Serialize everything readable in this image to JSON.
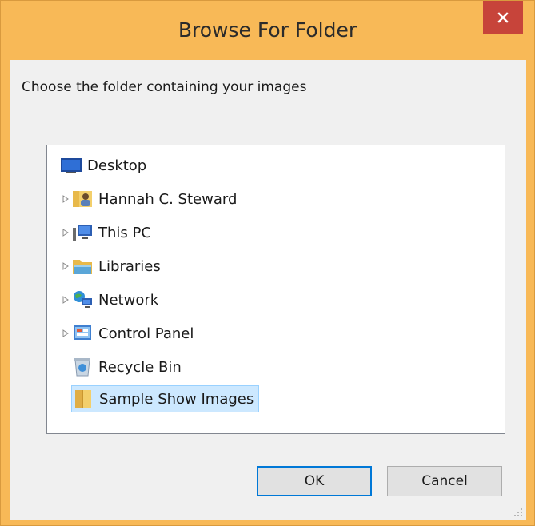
{
  "window": {
    "title": "Browse For Folder",
    "close_icon": "close-icon"
  },
  "dialog": {
    "instruction": "Choose the folder containing your images"
  },
  "tree": {
    "items": [
      {
        "label": "Desktop",
        "icon": "desktop-icon",
        "expandable": false,
        "selected": false
      },
      {
        "label": "Hannah C. Steward",
        "icon": "user-folder-icon",
        "expandable": true,
        "selected": false
      },
      {
        "label": "This PC",
        "icon": "computer-icon",
        "expandable": true,
        "selected": false
      },
      {
        "label": "Libraries",
        "icon": "libraries-icon",
        "expandable": true,
        "selected": false
      },
      {
        "label": "Network",
        "icon": "network-icon",
        "expandable": true,
        "selected": false
      },
      {
        "label": "Control Panel",
        "icon": "control-panel-icon",
        "expandable": true,
        "selected": false
      },
      {
        "label": "Recycle Bin",
        "icon": "recycle-bin-icon",
        "expandable": false,
        "selected": false
      },
      {
        "label": "Sample Show Images",
        "icon": "folder-icon",
        "expandable": false,
        "selected": true
      }
    ]
  },
  "buttons": {
    "ok_label": "OK",
    "cancel_label": "Cancel"
  },
  "colors": {
    "frame": "#f8b957",
    "close_button": "#c7443a",
    "selection": "#cce8ff",
    "default_button_border": "#0078d7"
  }
}
